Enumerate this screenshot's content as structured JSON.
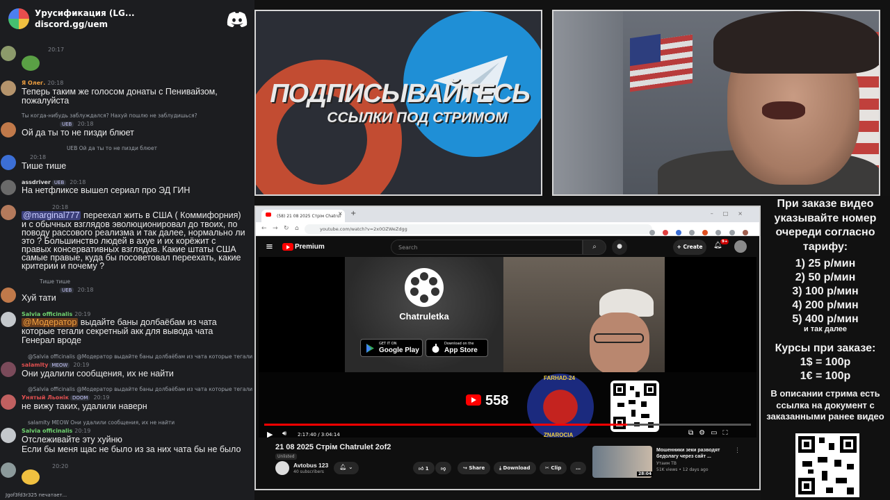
{
  "discord": {
    "server_name": "Урусификация (LG...",
    "invite": "discord.gg/uem",
    "messages": [
      {
        "time": "20:17"
      },
      {
        "author": "Я Олег.",
        "time": "20:18",
        "text1": "Теперь таким же голосом донаты с Пенивайзом,",
        "text2": "пожалуйста"
      },
      {
        "reply": "Ты когда-нибудь заблуждался? Нахуй пошлю не заблудишься?",
        "badge": "UEB",
        "time": "20:18",
        "text1": "Ой да ты то не пизди блюет"
      },
      {
        "reply": "Ой да ты то не пизди блюет",
        "reply_badge": "UEB",
        "time": "20:18",
        "text1": "Тише тише"
      },
      {
        "author": "assdriver",
        "badge": "UEB",
        "time": "20:18",
        "text1": "На нетфликсе вышел сериал про ЭД ГИН"
      },
      {
        "time": "20:18",
        "mention": "@marginal777",
        "text1": " переехал жить в США ( Коммифорния)",
        "text2": "и с обычных взглядов эволюционировал до твоих, по",
        "text3": "поводу рассового реализма и так далее, нормально ли",
        "text4": "это ? Большинство людей в ахуе и их корёжит с",
        "text5": "правых консервативных взглядов. Какие штаты США",
        "text6": "самые правые, куда бы посоветовал переехать, какие",
        "text7": "критерии и почему ?"
      },
      {
        "reply": "Тише тише",
        "badge": "UEB",
        "time": "20:18",
        "text1": "Хуй тати"
      },
      {
        "author": "Salvia officinalis",
        "time": "20:19",
        "mention": "@Модератор",
        "text1": " выдайте баны долбаёбам из чата",
        "text2": "которые тегали секретный акк для вывода чата",
        "text3": "Генерал вроде"
      },
      {
        "reply": "@Salvia officinalis @Модератор выдайте баны долбаёбам из чата которые тегали секретный ак",
        "author": "salamlty",
        "badge": "MEOW",
        "time": "20:19",
        "text1": "Они удалили сообщения, их не найти"
      },
      {
        "reply": "@Salvia officinalis @Модератор выдайте баны долбаёбам из чата которые тегали секретный ак",
        "author": "Унятый Льонік",
        "badge": "DOOM",
        "time": "20:19",
        "text1": "не вижу таких, удалили наверн"
      },
      {
        "reply": "salamlty MEOW Они удалили сообщения, их не найти",
        "author": "Salvia officinalis",
        "time": "20:19",
        "text1": "Отслеживайте эту хуйню",
        "text2": "Если бы меня щас не было из за них чата бы не было"
      },
      {
        "time": "20:20"
      }
    ],
    "typing": "Jgof3fd3r325 печатает..."
  },
  "promo": {
    "title": "ПОДПИСЫВАЙТЕСЬ",
    "subtitle": "ССЫЛКИ ПОД СТРИМОМ"
  },
  "browser": {
    "tab_title": "(58) 21 08 2025 Стрім Chatrul",
    "url": "youtube.com/watch?v=2x0OZWeZdgg",
    "yt": {
      "brand": "Premium",
      "search_placeholder": "Search",
      "create_label": "Create",
      "bell_count": "9+",
      "overlay": {
        "app_name": "Chatruletka",
        "google_small": "GET IT ON",
        "google_big": "Google Play",
        "apple_small": "Download on the",
        "apple_big": "App Store",
        "subscriber_count": "558",
        "badge_top": "FARHAD-24",
        "badge_left": "SULTAN",
        "badge_right": "RUSSKIE",
        "badge_bottom": "ZNAROCIA"
      },
      "player": {
        "time": "2:17:40 / 3:04:14",
        "progress": 0.745
      },
      "video_title": "21 08 2025 Стрім Chatrulet 2of2",
      "visibility": "Unlisted",
      "channel_name": "Avtobus 123",
      "channel_subs": "40 subscribers",
      "like_count": "1",
      "share_label": "Share",
      "download_label": "Download",
      "clip_label": "Clip",
      "recommendation": {
        "title": "Мошенники зеки разводят бедолагу через сайт ...",
        "channel": "Утаим ТВ",
        "views": "51K views • 12 days ago",
        "duration": "28:04"
      }
    }
  },
  "info_panel": {
    "order_text": "При заказе видео указывайте номер очереди согласно тарифу:",
    "tariffs": [
      "1) 25 р/мин",
      "2) 50 р/мин",
      "3) 100 р/мин",
      "4) 200 р/мин",
      "5) 400 р/мин"
    ],
    "etc": "и так далее",
    "courses_title": "Курсы при заказе:",
    "course_usd": "1$ = 100р",
    "course_eur": "1€ = 100р",
    "description_note": "В описании стрима есть ссылка на документ с заказанными ранее видео"
  }
}
